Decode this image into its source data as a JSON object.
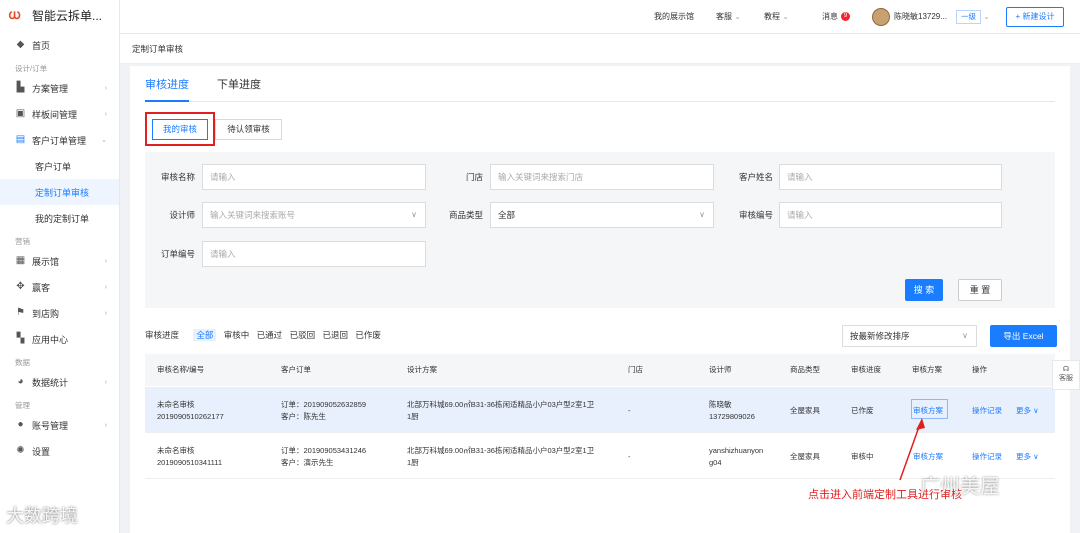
{
  "app": {
    "title": "智能云拆单..."
  },
  "sidebar": {
    "items": [
      {
        "key": "home",
        "label": "首页",
        "icon": "home-icon"
      },
      {
        "key": "group-design",
        "group": "设计/订单"
      },
      {
        "key": "plan",
        "label": "方案管理",
        "icon": "folder-icon"
      },
      {
        "key": "sample",
        "label": "样板间管理",
        "icon": "book-icon"
      },
      {
        "key": "customer",
        "label": "客户订单管理",
        "icon": "order-icon"
      },
      {
        "key": "customer-orders",
        "label": "客户订单",
        "sub": true
      },
      {
        "key": "custom-review",
        "label": "定制订单审核",
        "sub": true,
        "active": true
      },
      {
        "key": "my-custom",
        "label": "我的定制订单",
        "sub": true
      },
      {
        "key": "group-market",
        "group": "营销"
      },
      {
        "key": "showroom",
        "label": "展示馆",
        "icon": "showroom-icon"
      },
      {
        "key": "visitors",
        "label": "赢客",
        "icon": "handshake-icon"
      },
      {
        "key": "store",
        "label": "到店购",
        "icon": "flag-icon"
      },
      {
        "key": "apps",
        "label": "应用中心",
        "icon": "apps-icon"
      },
      {
        "key": "group-data",
        "group": "数据"
      },
      {
        "key": "stats",
        "label": "数据统计",
        "icon": "pie-chart-icon"
      },
      {
        "key": "group-manage",
        "group": "管理"
      },
      {
        "key": "account",
        "label": "账号管理",
        "icon": "user-icon"
      },
      {
        "key": "settings",
        "label": "设置",
        "icon": "gear-icon"
      }
    ]
  },
  "topbar": {
    "showroom": "我的展示馆",
    "service": "客服",
    "tutorial": "教程",
    "messages": "消息",
    "message_count": "9",
    "user": "陈晓敏13729...",
    "level": "一级",
    "new_design": "+ 新建设计"
  },
  "breadcrumb": "定制订单审核",
  "tabs": [
    "审核进度",
    "下单进度"
  ],
  "segments": [
    "我的审核",
    "待认领审核"
  ],
  "filters": {
    "review_name_label": "审核名称",
    "review_name_placeholder": "请输入",
    "store_label": "门店",
    "store_placeholder": "输入关键词来搜索门店",
    "customer_label": "客户姓名",
    "customer_placeholder": "请输入",
    "designer_label": "设计师",
    "designer_placeholder": "输入关键词来搜索账号",
    "product_label": "商品类型",
    "product_value": "全部",
    "review_no_label": "审核编号",
    "review_no_placeholder": "请输入",
    "order_no_label": "订单编号",
    "order_no_placeholder": "请输入",
    "search": "搜 索",
    "reset": "重 置"
  },
  "progress_filter": {
    "label": "审核进度",
    "options": [
      "全部",
      "审核中",
      "已通过",
      "已驳回",
      "已退回",
      "已作废"
    ]
  },
  "sort": {
    "value": "按最新修改排序"
  },
  "export": "导出 Excel",
  "table": {
    "headers": [
      "审核名称/编号",
      "客户订单",
      "设计方案",
      "门店",
      "设计师",
      "商品类型",
      "审核进度",
      "审核方案",
      "操作"
    ],
    "rows": [
      {
        "name": "未命名审核",
        "no": "2019090510262177",
        "order": "订单：201909052632859",
        "customer": "客户：陈先生",
        "design_l1": "北部万科城69.00㎡B31-36栋闲适精品小户03户型2室1卫",
        "design_l2": "1厨",
        "store": "-",
        "designer_l1": "陈晓敏",
        "designer_l2": "13729809026",
        "product": "全屋家具",
        "status": "已作废",
        "plan": "审核方案",
        "op": "操作记录",
        "more": "更多"
      },
      {
        "name": "未命名审核",
        "no": "2019090510341111",
        "order": "订单：201909053431246",
        "customer": "客户：演示先生",
        "design_l1": "北部万科城69.00㎡B31-36栋闲适精品小户03户型2室1卫",
        "design_l2": "1厨",
        "store": "-",
        "designer_l1": "yanshizhuanyon",
        "designer_l2": "g04",
        "product": "全屋家具",
        "status": "审核中",
        "plan": "审核方案",
        "op": "操作记录",
        "more": "更多"
      }
    ]
  },
  "annotation": "点击进入前端定制工具进行审核",
  "watermarks": {
    "right": "广州美屋",
    "left": "大数跨境"
  },
  "float_service": "客服",
  "colors": {
    "accent": "#1a7cff",
    "annotation": "#e02020"
  }
}
